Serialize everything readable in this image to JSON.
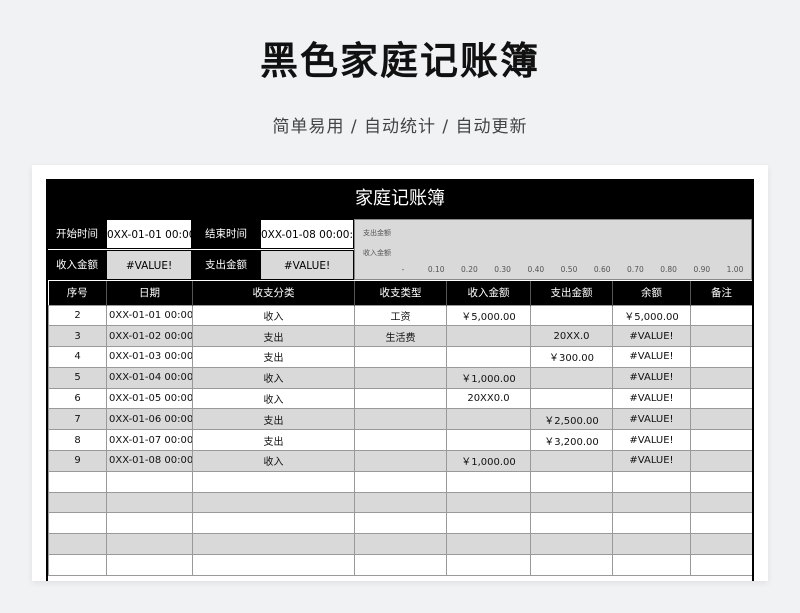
{
  "header": {
    "title": "黑色家庭记账簿",
    "subtitle": "简单易用 / 自动统计 / 自动更新"
  },
  "sheet": {
    "title": "家庭记账簿",
    "summary": {
      "start_label": "开始时间",
      "start_value": "0XX-01-01 00:00:0",
      "end_label": "结束时间",
      "end_value": "0XX-01-08 00:00:0",
      "income_label": "收入金额",
      "income_value": "#VALUE!",
      "expense_label": "支出金额",
      "expense_value": "#VALUE!"
    },
    "mini_chart": {
      "series": [
        "支出金额",
        "收入金额"
      ],
      "ticks": [
        "-",
        "0.10",
        "0.20",
        "0.30",
        "0.40",
        "0.50",
        "0.60",
        "0.70",
        "0.80",
        "0.90",
        "1.00"
      ]
    },
    "table": {
      "columns": [
        "序号",
        "日期",
        "收支分类",
        "收支类型",
        "收入金额",
        "支出金额",
        "余额",
        "备注"
      ],
      "rows": [
        [
          "2",
          "0XX-01-01 00:00:0",
          "收入",
          "工资",
          "￥5,000.00",
          "",
          "￥5,000.00",
          ""
        ],
        [
          "3",
          "0XX-01-02 00:00:0",
          "支出",
          "生活费",
          "",
          "20XX.0",
          "#VALUE!",
          ""
        ],
        [
          "4",
          "0XX-01-03 00:00:0",
          "支出",
          "",
          "",
          "￥300.00",
          "#VALUE!",
          ""
        ],
        [
          "5",
          "0XX-01-04 00:00:0",
          "收入",
          "",
          "￥1,000.00",
          "",
          "#VALUE!",
          ""
        ],
        [
          "6",
          "0XX-01-05 00:00:0",
          "收入",
          "",
          "20XX0.0",
          "",
          "#VALUE!",
          ""
        ],
        [
          "7",
          "0XX-01-06 00:00:0",
          "支出",
          "",
          "",
          "￥2,500.00",
          "#VALUE!",
          ""
        ],
        [
          "8",
          "0XX-01-07 00:00:0",
          "支出",
          "",
          "",
          "￥3,200.00",
          "#VALUE!",
          ""
        ],
        [
          "9",
          "0XX-01-08 00:00:0",
          "收入",
          "",
          "￥1,000.00",
          "",
          "#VALUE!",
          ""
        ],
        [
          "",
          "",
          "",
          "",
          "",
          "",
          "",
          ""
        ],
        [
          "",
          "",
          "",
          "",
          "",
          "",
          "",
          ""
        ],
        [
          "",
          "",
          "",
          "",
          "",
          "",
          "",
          ""
        ],
        [
          "",
          "",
          "",
          "",
          "",
          "",
          "",
          ""
        ],
        [
          "",
          "",
          "",
          "",
          "",
          "",
          "",
          ""
        ]
      ]
    }
  }
}
